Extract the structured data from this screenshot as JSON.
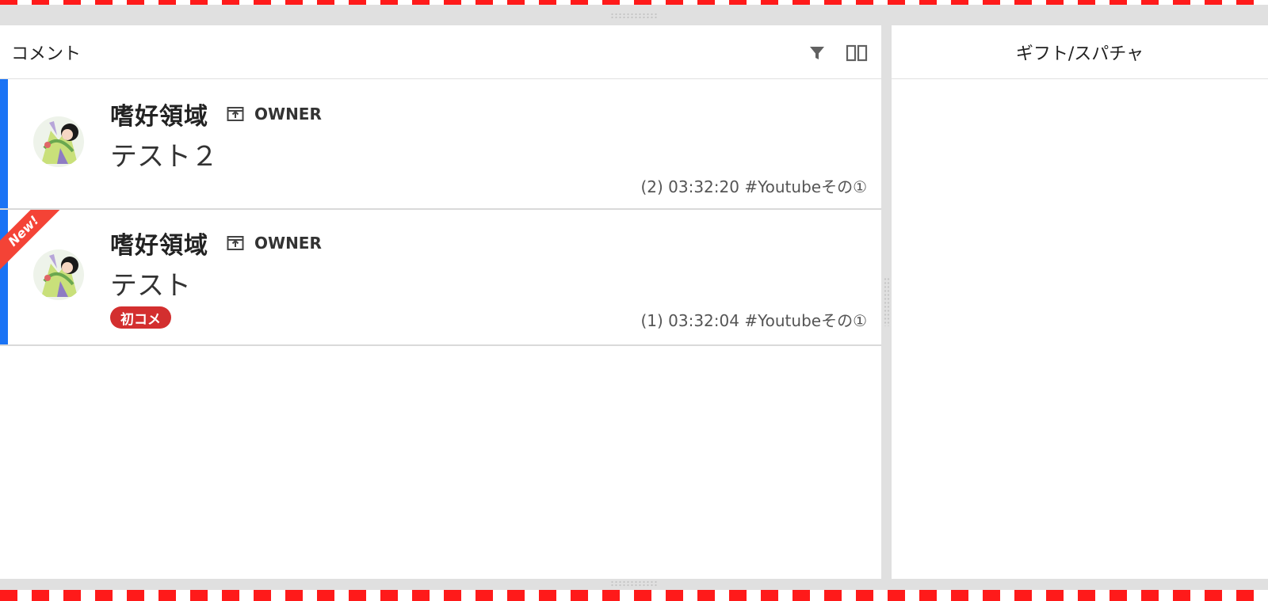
{
  "colors": {
    "dash_red": "#ff1a1a",
    "accent_blue": "#1a73f5",
    "badge_red": "#d32f2f",
    "ribbon_red": "#f44336"
  },
  "comment_panel": {
    "title": "コメント",
    "filter_icon": "filter-icon",
    "columns_icon": "columns-icon"
  },
  "gift_panel": {
    "title": "ギフト/スパチャ"
  },
  "comments": [
    {
      "author": "嗜好領域",
      "role": "OWNER",
      "role_icon": "upload-box-icon",
      "message": "テスト２",
      "meta": "(2) 03:32:20  #Youtubeその①",
      "new_ribbon": "",
      "badge": ""
    },
    {
      "author": "嗜好領域",
      "role": "OWNER",
      "role_icon": "upload-box-icon",
      "message": "テスト",
      "meta": "(1) 03:32:04  #Youtubeその①",
      "new_ribbon": "New!",
      "badge": "初コメ"
    }
  ]
}
